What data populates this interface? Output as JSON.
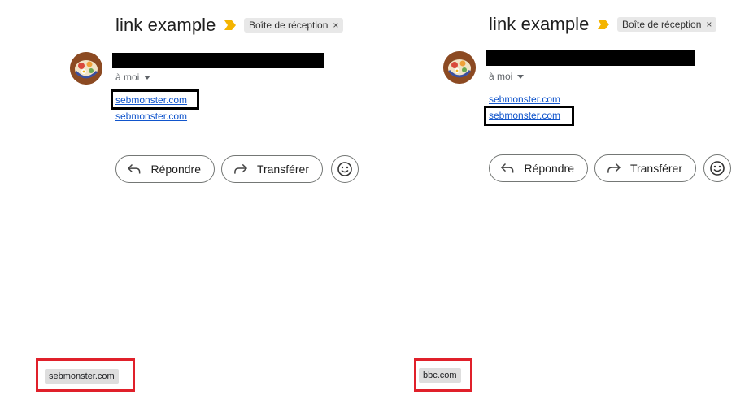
{
  "panels": [
    {
      "subject": "link example",
      "label": "Boîte de réception",
      "label_close": "×",
      "recipient": "à moi",
      "links": [
        "sebmonster.com",
        "sebmonster.com"
      ],
      "actions": {
        "reply": "Répondre",
        "forward": "Transférer"
      },
      "status_url": "sebmonster.com"
    },
    {
      "subject": "link example",
      "label": "Boîte de réception",
      "label_close": "×",
      "recipient": "à moi",
      "links": [
        "sebmonster.com",
        "sebmonster.com"
      ],
      "actions": {
        "reply": "Répondre",
        "forward": "Transférer"
      },
      "status_url": "bbc.com"
    }
  ],
  "icons": {
    "importance": "importance-marker-icon",
    "reply": "reply-arrow-icon",
    "forward": "forward-arrow-icon",
    "emoji": "emoji-smiley-icon",
    "caret": "caret-down-icon"
  },
  "colors": {
    "link": "#1155cc",
    "importance": "#f4b400",
    "highlight_black": "#000000",
    "highlight_red": "#e0202a"
  }
}
